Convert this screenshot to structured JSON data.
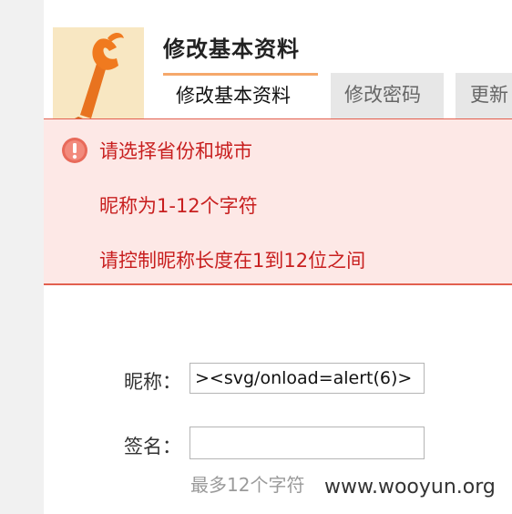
{
  "header": {
    "title": "修改基本资料"
  },
  "tabs": [
    {
      "label": "修改基本资料",
      "active": true
    },
    {
      "label": "修改密码",
      "active": false
    },
    {
      "label": "更新",
      "active": false
    }
  ],
  "errors": {
    "icon": "error-circle-icon",
    "messages": [
      "请选择省份和城市",
      "昵称为1-12个字符",
      "请控制昵称长度在1到12位之间"
    ]
  },
  "form": {
    "nickname_label": "昵称：",
    "nickname_value": "><svg/onload=alert(6)>",
    "signature_label": "签名：",
    "signature_value": "",
    "signature_hint": "最多12个字符"
  },
  "watermark": "www.wooyun.org",
  "colors": {
    "accent": "#f5a86b",
    "error_text": "#c81f1f",
    "error_border": "#e2604f",
    "error_bg": "#fde8e6"
  }
}
